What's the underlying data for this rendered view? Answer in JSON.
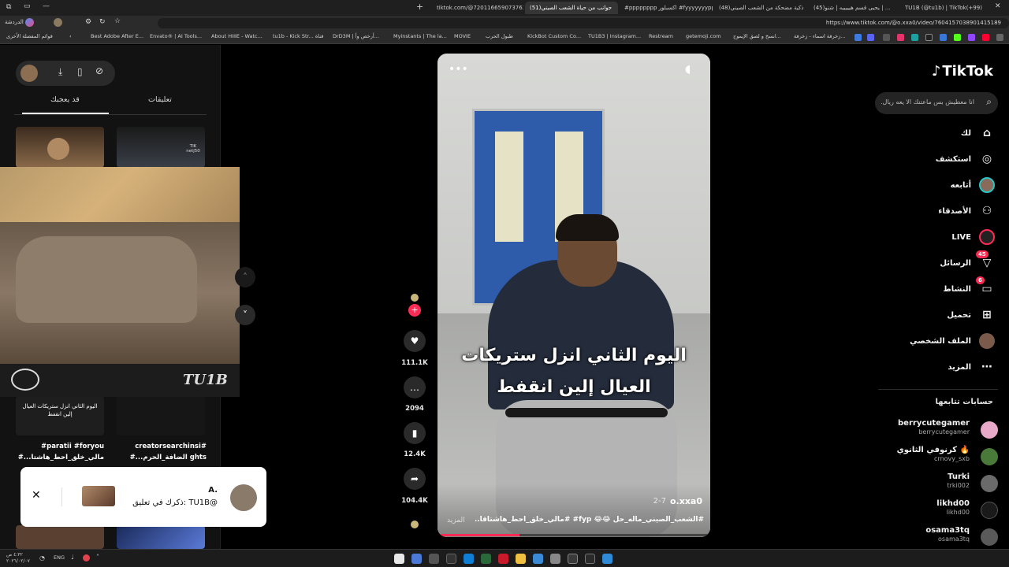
{
  "browser": {
    "tabs": [
      {
        "label": "tiktok.com/@72011665907376302"
      },
      {
        "label": "(51)جوانب من حياة الشعب الصيني"
      },
      {
        "label": "#pppppppp اكسبلور #fyyyyyyyppppp"
      },
      {
        "label": "(48)ذكية مضحكة من الشعب الصيني"
      },
      {
        "label": "(45)يحيى قسم هيييييه | شنو | ..."
      },
      {
        "label": "TU1B (@tu1b) | TikTok(+99)"
      }
    ],
    "address_url": "https://www.tiktok.com/@o.xxa0/video/7604157038901415189",
    "bookmarks_label": "قوائم المفضلة الأخرى",
    "bookmarks": [
      "Best Adobe After E...",
      "Envato® | AI Tools...",
      "About HIIIE - Watc...",
      "tu1b - Kick Str... قناة",
      "DrD3M | أرخص وأ...",
      "Myinstants | The la...",
      "MOVIE",
      "طبول الحرب",
      "KickBot Custom Co...",
      "TU1B3 | Instagram...",
      "Restream",
      "getemoji.com",
      "انسخ و لصق الإيموج...",
      "زخرفة اسماء - زخرفة..."
    ],
    "profile_label": "الدردشة"
  },
  "left_panel": {
    "tabs": {
      "liked": "قد يعجبك",
      "comments": "تعليقات"
    },
    "thumb_labels": [
      "paratii #foryou# مالي_خلق_احط_هاشتا...#",
      "creatorsearchinsi# ghts الضافة_الحرم...#"
    ],
    "video_caption": "اليوم الثاني انزل ستريكات العيال إلين انقفط",
    "thumb_tag": "TIK netj50",
    "overlay_logo": "TU1B"
  },
  "notification": {
    "user": "A.",
    "text": "ذكرك في تعليق: TU1B@"
  },
  "video": {
    "caption_line1": "اليوم الثاني انزل ستريكات",
    "caption_line2": "العيال إلين انقفط",
    "author": "o.xxa0",
    "date": "2-7",
    "description": "#الشعب_الصيني_ماله_حل 😂😂 fyp# #مالي_خلق_احط_هاشتاقا...",
    "more_label": "المزيد",
    "progress": 0.3
  },
  "actions": {
    "likes": "111.1K",
    "comments": "2094",
    "saves": "12.4K",
    "shares": "104.4K"
  },
  "sidebar": {
    "logo": "TikTok",
    "search_placeholder": "انا معطيش بس ماعتنك الا يعه ريال...",
    "items": [
      {
        "label": "لك",
        "icon": "home-icon"
      },
      {
        "label": "استكشف",
        "icon": "compass-icon"
      },
      {
        "label": "أتابعه",
        "icon": "following-icon"
      },
      {
        "label": "الأصدقاء",
        "icon": "friends-icon"
      },
      {
        "label": "LIVE",
        "icon": "live-icon"
      },
      {
        "label": "الرسائل",
        "icon": "messages-icon",
        "badge": "45"
      },
      {
        "label": "النشاط",
        "icon": "activity-icon",
        "badge": "6"
      },
      {
        "label": "تحميل",
        "icon": "upload-icon"
      },
      {
        "label": "الملف الشخصي",
        "icon": "profile-icon"
      },
      {
        "label": "المزيد",
        "icon": "more-icon"
      }
    ],
    "following_title": "حسابات تتابعها",
    "following": [
      {
        "name": "berrycutegamer",
        "handle": "berrycutegamer"
      },
      {
        "name": "كرنوفي الثانوي 🔥",
        "handle": "crnovy_sxb"
      },
      {
        "name": "Turki",
        "handle": "trki002"
      },
      {
        "name": "likhd00",
        "handle": "likhd00"
      },
      {
        "name": "osama3tq",
        "handle": "osama3tq"
      }
    ]
  },
  "taskbar": {
    "lang": "ENG",
    "time": "٤:٣٢ ص",
    "date": "٢٠٢٦/٠٢/٠٧"
  }
}
